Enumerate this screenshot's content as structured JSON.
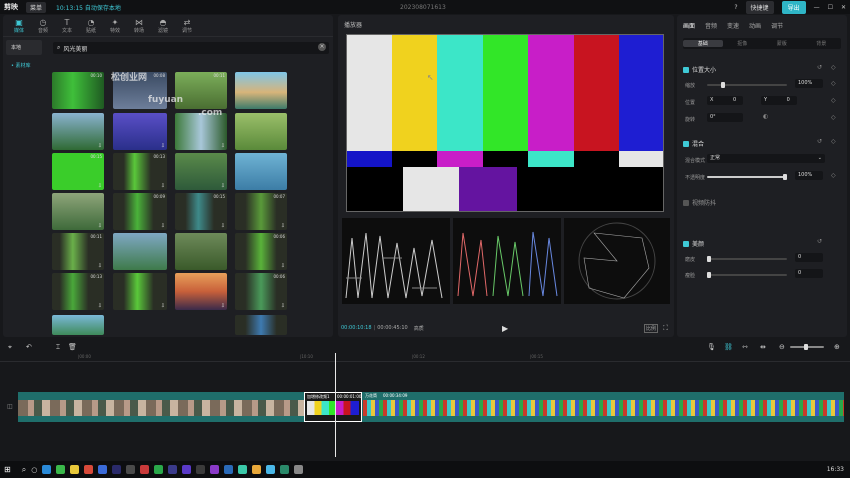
{
  "titlebar": {
    "app_name": "剪映",
    "menu_label": "菜单",
    "status_text": "10:13:15 自动保存本地",
    "project_name": "202308071613",
    "shortcut_label": "快捷键",
    "export_label": "导出"
  },
  "toolbar": {
    "tools": [
      {
        "label": "媒体",
        "icon": "media-icon"
      },
      {
        "label": "音频",
        "icon": "audio-icon"
      },
      {
        "label": "文本",
        "icon": "text-icon"
      },
      {
        "label": "贴纸",
        "icon": "sticker-icon"
      },
      {
        "label": "特效",
        "icon": "effects-icon"
      },
      {
        "label": "转场",
        "icon": "transition-icon"
      },
      {
        "label": "滤镜",
        "icon": "filter-icon"
      },
      {
        "label": "调节",
        "icon": "adjust-icon"
      }
    ]
  },
  "sidenav": {
    "local": "本地",
    "library": "• 素材库"
  },
  "search": {
    "value": "风光美丽"
  },
  "thumbs": {
    "durations": [
      "00:10",
      "00:08",
      "00:11",
      "00:15",
      "00:13",
      "00:09",
      "00:15",
      "00:07",
      "00:11",
      "00:06",
      "00:13",
      "00:06"
    ]
  },
  "watermark": {
    "line1": "松创业网",
    "line2": "fuyuan",
    "line3": ".com"
  },
  "player": {
    "title": "播放器",
    "current_time": "00:00:10:18",
    "total_time": "00:00:45:10",
    "quality": "高质",
    "ratio": "比例"
  },
  "props": {
    "tabs": [
      "画面",
      "音频",
      "变速",
      "动画",
      "调节"
    ],
    "subtabs": [
      "基础",
      "抠像",
      "蒙版",
      "背景"
    ],
    "position_size": "位置大小",
    "scale_label": "缩放",
    "scale_value": "100%",
    "position_label": "位置",
    "pos_x": "0",
    "pos_y": "0",
    "rotate_label": "旋转",
    "rotate_value": "0°",
    "blend": "混合",
    "blend_mode_label": "混合模式",
    "blend_mode_value": "正常",
    "opacity_label": "不透明度",
    "opacity_value": "100%",
    "stabilize": "视频防抖",
    "beauty": "美颜",
    "smooth_label": "磨皮",
    "smooth_value": "0",
    "thin_label": "瘦脸",
    "thin_value": "0"
  },
  "timeline": {
    "ruler": [
      "|00:00",
      "|10:10",
      "|00:12",
      "|00:15"
    ],
    "clip_label": "加增修改频1",
    "clip_time": "00:00:01:00",
    "clip2_label": "万花筒",
    "clip2_time": "00:00:34:09"
  },
  "taskbar": {
    "time": "16:33"
  },
  "colors": {
    "accent": "#3fc9d6",
    "track": "#1f6e6b"
  }
}
